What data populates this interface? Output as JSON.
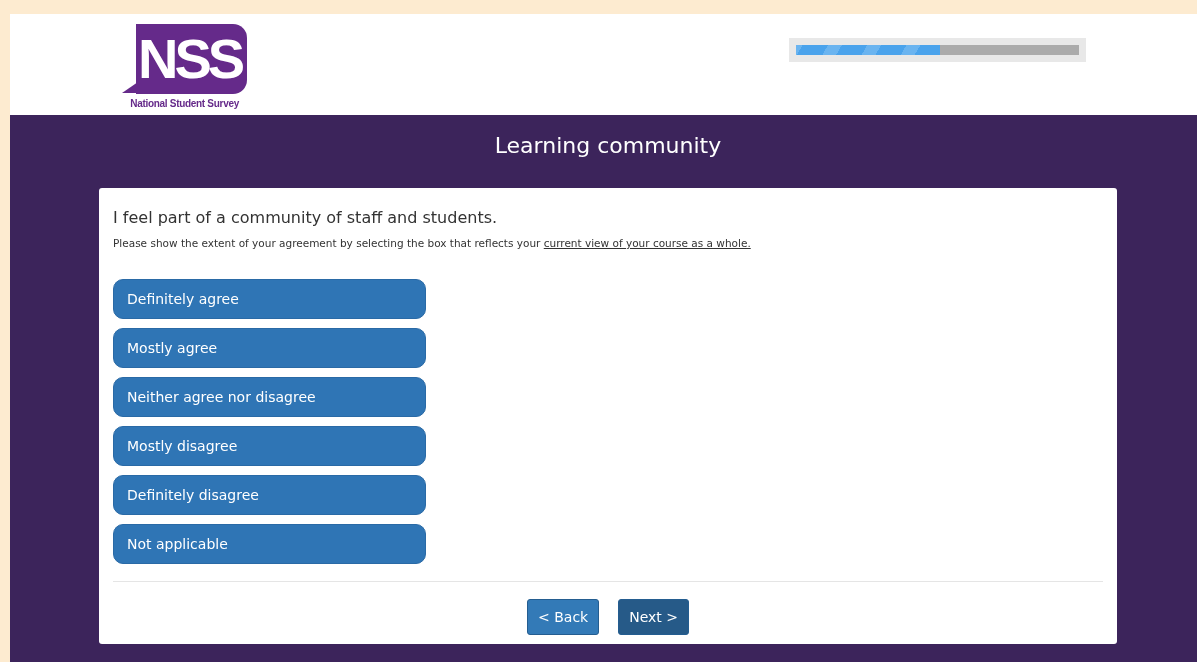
{
  "logo": {
    "mark": "NSS",
    "name": "National Student Survey"
  },
  "progress": {
    "level": 0.51
  },
  "section_title": "Learning community",
  "question": {
    "text": "I feel part of a community of staff and students.",
    "instruction": "Please show the extent of your agreement by selecting the box that reflects your",
    "instruction_link": "current view of your course as a whole.",
    "options": [
      {
        "label": "Definitely agree",
        "selected": false
      },
      {
        "label": "Mostly agree",
        "selected": false
      },
      {
        "label": "Neither agree nor disagree",
        "selected": false
      },
      {
        "label": "Mostly disagree",
        "selected": false
      },
      {
        "label": "Definitely disagree",
        "selected": false
      },
      {
        "label": "Not applicable",
        "selected": false
      }
    ]
  },
  "buttons": [
    {
      "label": "< Back",
      "kind": "secondary"
    },
    {
      "label": "Next >",
      "kind": "primary"
    }
  ]
}
